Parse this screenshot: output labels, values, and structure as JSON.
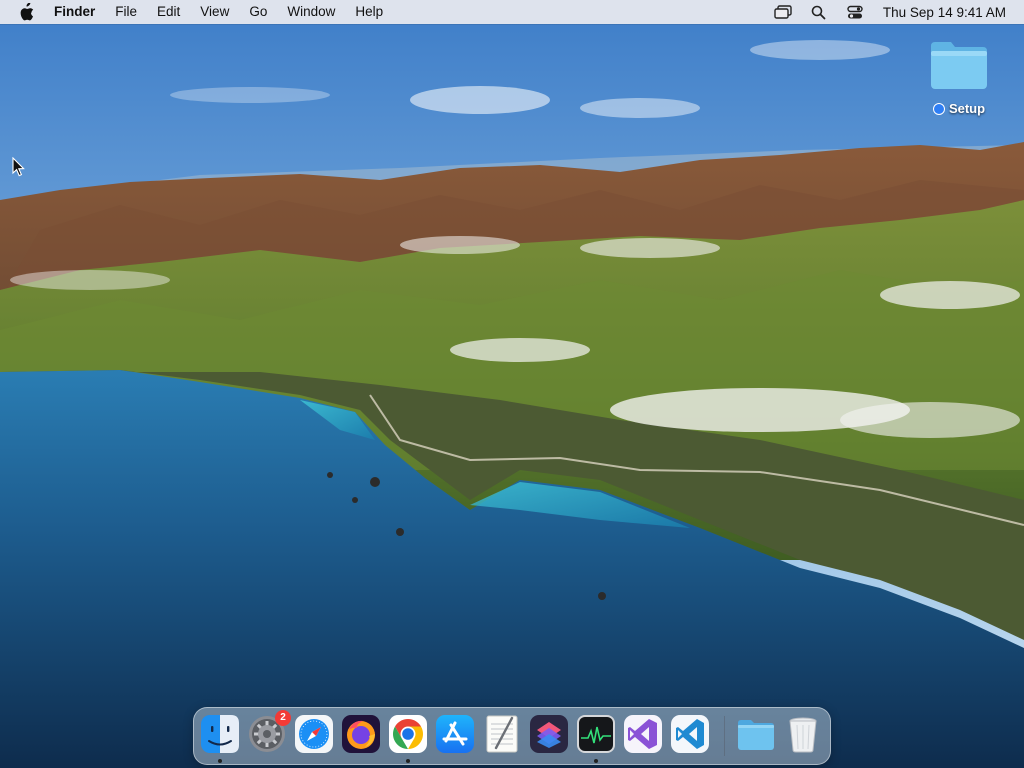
{
  "menubar": {
    "app_name": "Finder",
    "menus": [
      "File",
      "Edit",
      "View",
      "Go",
      "Window",
      "Help"
    ],
    "clock": "Thu Sep 14  9:41 AM",
    "status_icons": [
      "screen-mirroring-icon",
      "spotlight-search-icon",
      "control-center-icon"
    ]
  },
  "desktop": {
    "folder": {
      "label": "Setup",
      "tag_color": "#2f7ff5"
    }
  },
  "dock": {
    "apps": [
      {
        "name": "Finder",
        "icon": "finder-icon",
        "running": true
      },
      {
        "name": "System Settings",
        "icon": "system-settings-icon",
        "badge": "2",
        "running": false
      },
      {
        "name": "Safari",
        "icon": "safari-icon",
        "running": false
      },
      {
        "name": "Firefox",
        "icon": "firefox-icon",
        "running": false
      },
      {
        "name": "Google Chrome",
        "icon": "chrome-icon",
        "running": true
      },
      {
        "name": "App Store",
        "icon": "app-store-icon",
        "running": false
      },
      {
        "name": "TextEdit",
        "icon": "textedit-icon",
        "running": false
      },
      {
        "name": "Shortcuts",
        "icon": "shortcuts-icon",
        "running": false
      },
      {
        "name": "Activity Monitor",
        "icon": "activity-monitor-icon",
        "running": true
      },
      {
        "name": "Visual Studio",
        "icon": "visual-studio-icon",
        "running": false
      },
      {
        "name": "Visual Studio Code",
        "icon": "vscode-icon",
        "running": false
      }
    ],
    "others": [
      {
        "name": "Downloads",
        "icon": "downloads-folder-icon"
      },
      {
        "name": "Trash",
        "icon": "trash-icon"
      }
    ]
  },
  "colors": {
    "sky_top": "#3d7dc8",
    "sea": "#1d5c8e",
    "accent_blue": "#2f7ff5",
    "badge_red": "#f23a36"
  }
}
